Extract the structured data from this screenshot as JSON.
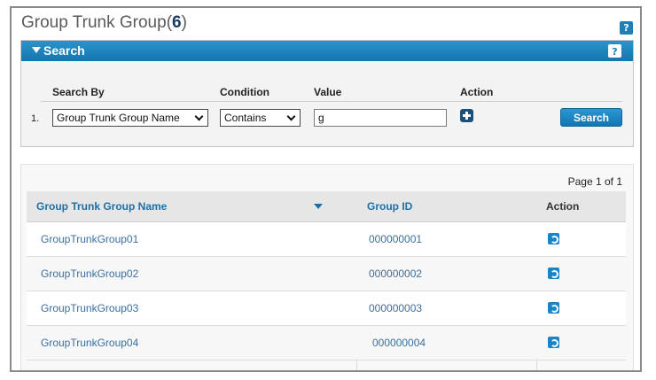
{
  "page": {
    "title": "Group Trunk Group(",
    "count": "6",
    "title_close": ")",
    "help_label": "?"
  },
  "search": {
    "header": "Search",
    "help_label": "?",
    "columns": {
      "search_by": "Search By",
      "condition": "Condition",
      "value": "Value",
      "action": "Action"
    },
    "row_number": "1.",
    "search_by_selected": "Group Trunk Group Name",
    "condition_selected": "Contains",
    "value": "g",
    "search_button": "Search"
  },
  "results": {
    "pager": "Page 1 of 1",
    "columns": {
      "name": "Group Trunk Group Name",
      "group_id": "Group ID",
      "action": "Action"
    },
    "rows": [
      {
        "name": "GroupTrunkGroup01",
        "group_id": "000000001"
      },
      {
        "name": "GroupTrunkGroup02",
        "group_id": "000000002"
      },
      {
        "name": "GroupTrunkGroup03",
        "group_id": "000000003"
      },
      {
        "name": "GroupTrunkGroup04",
        "group_id": "000000004"
      }
    ]
  },
  "colors": {
    "accent": "#1d7fb8",
    "link": "#3a6fa0",
    "header_text": "#1e6fa8"
  },
  "icons": [
    "help-icon",
    "caret-down-icon",
    "chevron-down-icon",
    "add-icon",
    "sort-desc-icon",
    "edit-icon"
  ]
}
